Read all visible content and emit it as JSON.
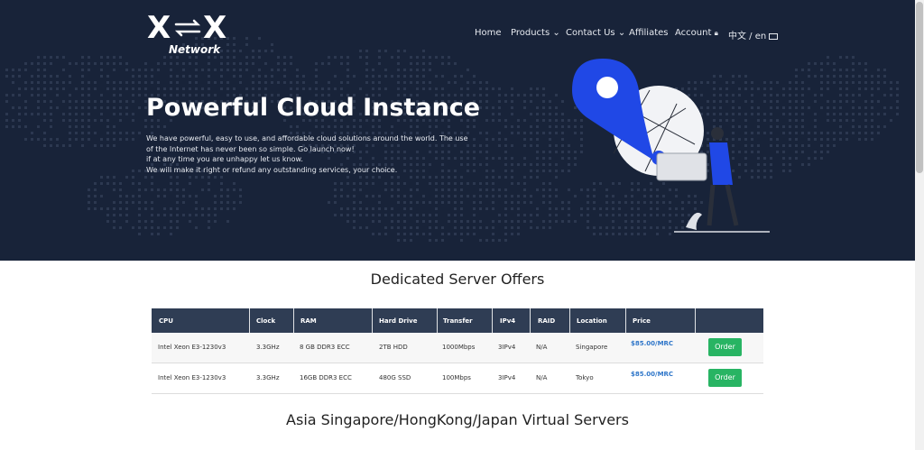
{
  "brand": {
    "logo_letter_left": "X",
    "logo_letter_right": "X",
    "logo_subtitle": "Network"
  },
  "nav": {
    "home": "Home",
    "products": "Products",
    "contact": "Contact Us",
    "affiliates": "Affiliates",
    "account": "Account",
    "language": "中文 / en"
  },
  "hero": {
    "title": "Powerful Cloud Instance",
    "lines": [
      "We have powerful, easy to use, and affordable cloud solutions around the world. The use",
      "of the Internet has never been so simple. Go launch now!",
      "if at any time you are unhappy let us know.",
      "We will make it right or refund any outstanding services, your choice."
    ]
  },
  "dedicated": {
    "title": "Dedicated Server Offers",
    "columns": [
      "CPU",
      "Clock",
      "RAM",
      "Hard Drive",
      "Transfer",
      "IPv4",
      "RAID",
      "Location",
      "Price"
    ],
    "rows": [
      {
        "cpu": "Intel Xeon E3-1230v3",
        "clock": "3.3GHz",
        "ram": "8 GB DDR3 ECC",
        "drive": "2TB HDD",
        "transfer": "1000Mbps",
        "ipv4": "3IPv4",
        "raid": "N/A",
        "location": "Singapore",
        "price": "$85.00/MRC",
        "action": "Order"
      },
      {
        "cpu": "Intel Xeon E3-1230v3",
        "clock": "3.3GHz",
        "ram": "16GB DDR3 ECC",
        "drive": "480G SSD",
        "transfer": "100Mbps",
        "ipv4": "3IPv4",
        "raid": "N/A",
        "location": "Tokyo",
        "price": "$85.00/MRC",
        "action": "Order"
      }
    ]
  },
  "virtual": {
    "title": "Asia Singapore/HongKong/Japan Virtual Servers"
  },
  "colors": {
    "hero_bg": "#182339",
    "table_header": "#2f3d54",
    "order_button": "#28b463",
    "price": "#2f76c9",
    "illustration_accent": "#2048e6"
  },
  "icons": {
    "products_dropdown": "chevron-down-icon",
    "contact_dropdown": "chevron-down-icon",
    "account_lock": "lock-icon",
    "language_flag": "flag-icon"
  }
}
